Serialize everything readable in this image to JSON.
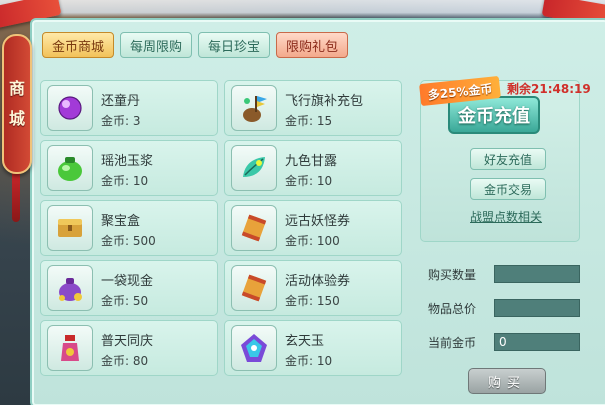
{
  "side_tab": {
    "chars": [
      "商",
      "城"
    ]
  },
  "tabs": [
    {
      "label": "金币商城",
      "state": "active"
    },
    {
      "label": "每周限购",
      "state": "normal"
    },
    {
      "label": "每日珍宝",
      "state": "normal"
    },
    {
      "label": "限购礼包",
      "state": "special"
    }
  ],
  "currency_label": "金币:",
  "items": [
    {
      "name": "还童丹",
      "price": "3",
      "icon": "purple-pill-icon"
    },
    {
      "name": "飞行旗补充包",
      "price": "15",
      "icon": "flag-bag-icon"
    },
    {
      "name": "瑶池玉浆",
      "price": "10",
      "icon": "green-jar-icon"
    },
    {
      "name": "九色甘露",
      "price": "10",
      "icon": "green-leaf-icon"
    },
    {
      "name": "聚宝盒",
      "price": "500",
      "icon": "treasure-box-icon"
    },
    {
      "name": "远古妖怪券",
      "price": "100",
      "icon": "scroll-icon"
    },
    {
      "name": "一袋现金",
      "price": "50",
      "icon": "money-bag-icon"
    },
    {
      "name": "活动体验券",
      "price": "150",
      "icon": "scroll-icon"
    },
    {
      "name": "普天同庆",
      "price": "80",
      "icon": "firework-bottle-icon"
    },
    {
      "name": "玄天玉",
      "price": "10",
      "icon": "jade-gem-icon"
    }
  ],
  "right": {
    "discount": "多25%金币",
    "countdown": "剩余21:48:19",
    "charge_label": "金币充值",
    "friend_charge": "好友充值",
    "gold_trade": "金币交易",
    "guild_points": "战盟点数相关"
  },
  "purchase": {
    "qty_label": "购买数量",
    "qty_value": "",
    "total_label": "物品总价",
    "total_value": "",
    "current_label": "当前金币",
    "current_value": "0",
    "buy_label": "购买"
  },
  "colors": {
    "panel": "#cfeee7",
    "active_tab": "#f2c25a",
    "special_tab": "#f3a98c",
    "charge_button": "#3aa898",
    "countdown": "#d0302a"
  }
}
